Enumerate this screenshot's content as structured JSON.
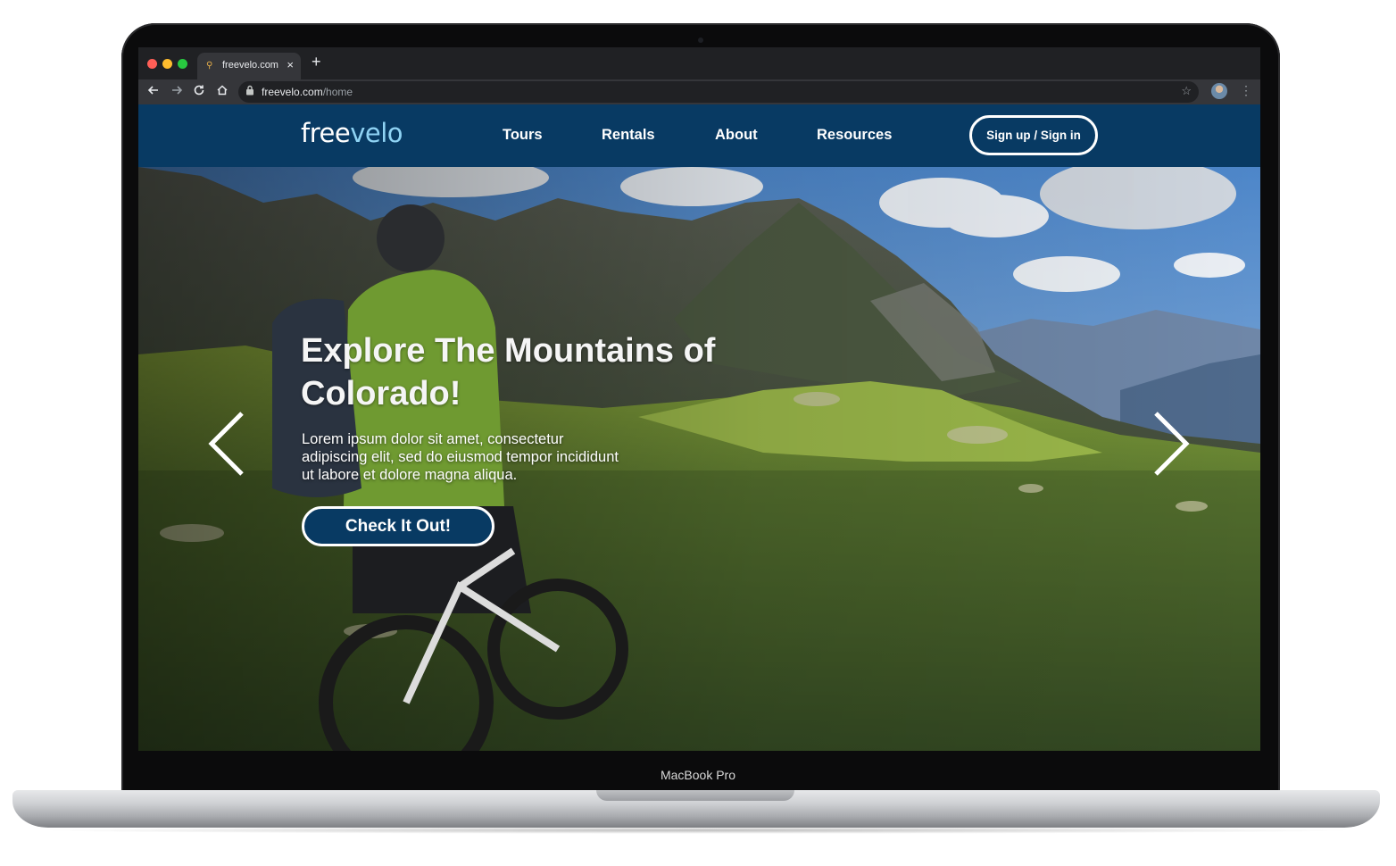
{
  "device": {
    "label": "MacBook Pro"
  },
  "browser": {
    "tab_title": "freevelo.com",
    "tab_close_glyph": "×",
    "new_tab_glyph": "+",
    "url_host": "freevelo.com",
    "url_path": "/home",
    "icons": [
      "back-icon",
      "forward-icon",
      "reload-icon",
      "home-icon",
      "lock-icon",
      "bookmark-star-icon",
      "profile-avatar",
      "menu-kebab-icon"
    ]
  },
  "site": {
    "logo_prefix": "free",
    "logo_suffix": "velo",
    "nav": [
      {
        "label": "Tours"
      },
      {
        "label": "Rentals"
      },
      {
        "label": "About"
      },
      {
        "label": "Resources"
      }
    ],
    "auth_label": "Sign up / Sign in"
  },
  "hero": {
    "title": "Explore The Mountains of Colorado!",
    "body": "Lorem ipsum dolor sit amet, consectetur adipiscing elit, sed do eiusmod tempor incididunt ut labore et dolore magna aliqua.",
    "cta_label": "Check It Out!",
    "prev_icon": "chevron-left-icon",
    "next_icon": "chevron-right-icon"
  },
  "colors": {
    "header_bg": "#083a63",
    "logo_accent": "#8fd3f4",
    "cta_bg": "#083a63",
    "text_light": "#ffffff"
  }
}
